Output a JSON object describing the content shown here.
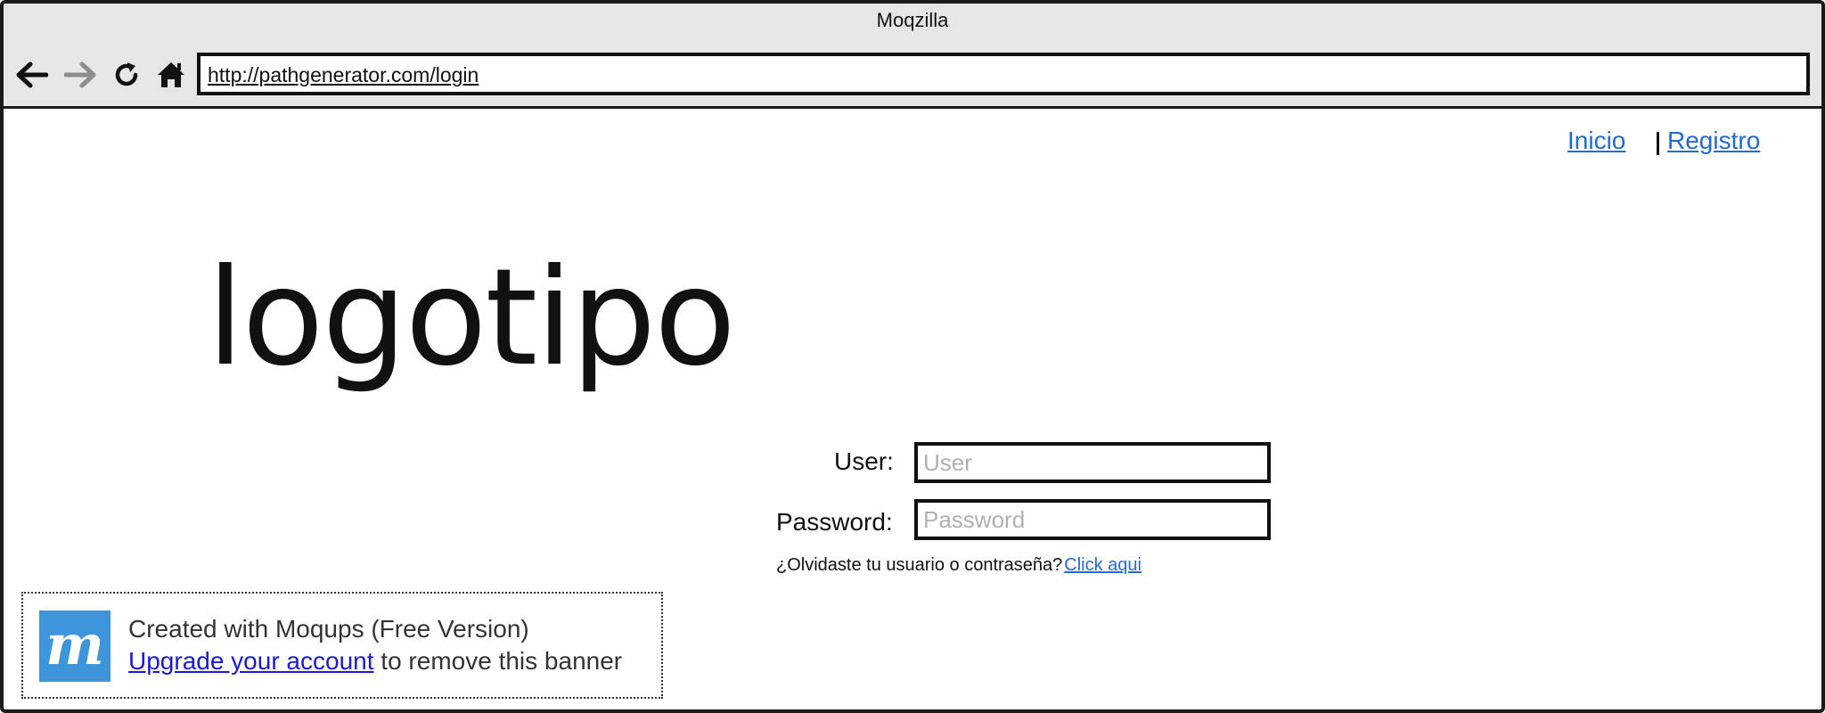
{
  "window": {
    "title": "Moqzilla"
  },
  "toolbar": {
    "buttons": [
      {
        "name": "back",
        "icon": "arrow-left-icon"
      },
      {
        "name": "forward",
        "icon": "arrow-right-icon"
      },
      {
        "name": "reload",
        "icon": "reload-icon"
      },
      {
        "name": "home",
        "icon": "home-icon"
      }
    ],
    "url": "http://pathgenerator.com/login"
  },
  "nav": {
    "inicio": "Inicio",
    "registro": "Registro"
  },
  "logo": {
    "text": "logotipo"
  },
  "login": {
    "user_label": "User:",
    "user_placeholder": "User",
    "password_label": "Password:",
    "password_placeholder": "Password",
    "forgot_text": "¿Olvidaste tu usuario o contraseña?",
    "forgot_link": "Click aqui"
  },
  "banner": {
    "logo_letter": "m",
    "line1": "Created with Moqups (Free Version)",
    "upgrade_link": "Upgrade your account",
    "line2_suffix": " to remove this banner"
  },
  "colors": {
    "link": "#1f6ad6",
    "chrome": "#e6e6e6",
    "border": "#1a1a1a",
    "banner_logo": "#3d96d9",
    "placeholder": "#b0b0b0"
  }
}
